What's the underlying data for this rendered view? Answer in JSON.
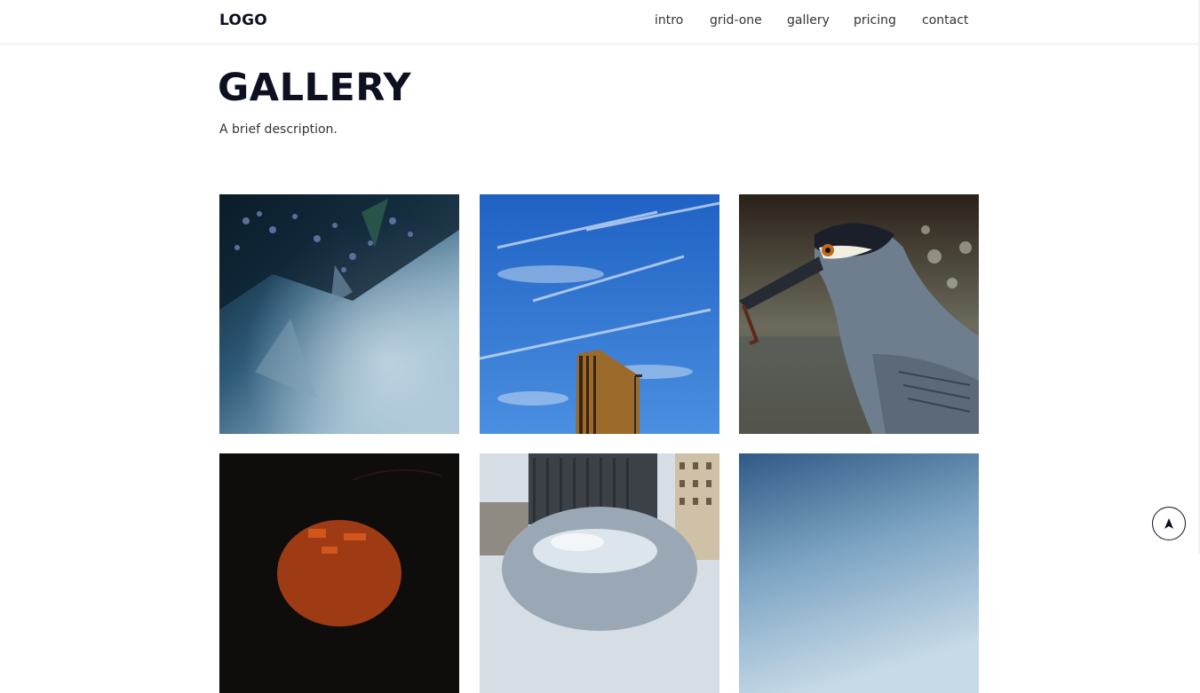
{
  "header": {
    "logo": "LOGO",
    "nav": [
      {
        "label": "intro"
      },
      {
        "label": "grid-one"
      },
      {
        "label": "gallery"
      },
      {
        "label": "pricing"
      },
      {
        "label": "contact"
      }
    ]
  },
  "main": {
    "title": "GALLERY",
    "description": "A brief description."
  },
  "gallery": {
    "items": [
      {
        "subject": "blue-flowers-photo"
      },
      {
        "subject": "sky-building-photo"
      },
      {
        "subject": "heron-photo"
      },
      {
        "subject": "red-lamp-photo"
      },
      {
        "subject": "bean-sculpture-photo"
      },
      {
        "subject": "blue-sky-photo"
      }
    ]
  },
  "scroll_top": {
    "icon": "arrow-up-icon"
  }
}
